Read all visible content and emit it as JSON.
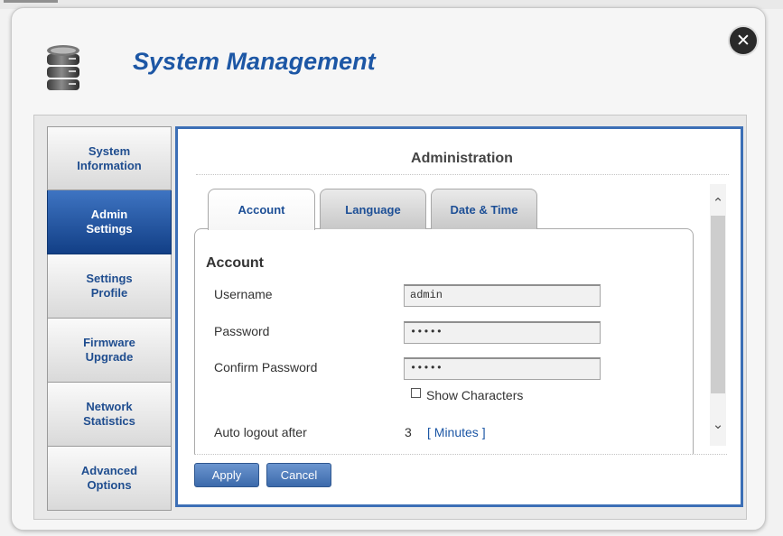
{
  "window": {
    "title": "System Management",
    "close_icon": "close-icon",
    "app_icon": "database-icon"
  },
  "sidebar": {
    "items": [
      {
        "label": "System Information"
      },
      {
        "label": "Admin Settings",
        "active": true
      },
      {
        "label": "Settings Profile"
      },
      {
        "label": "Firmware Upgrade"
      },
      {
        "label": "Network Statistics"
      },
      {
        "label": "Advanced Options"
      }
    ]
  },
  "main": {
    "title": "Administration",
    "tabs": [
      {
        "label": "Account",
        "active": true
      },
      {
        "label": "Language"
      },
      {
        "label": "Date & Time"
      }
    ],
    "account": {
      "heading": "Account",
      "username_label": "Username",
      "username_value": "admin",
      "password_label": "Password",
      "password_value": "•••••",
      "confirm_label": "Confirm Password",
      "confirm_value": "•••••",
      "show_characters_label": "Show Characters",
      "show_characters_checked": false,
      "auto_logout_label": "Auto logout after",
      "auto_logout_value": "3",
      "auto_logout_unit": "[ Minutes ]"
    },
    "buttons": {
      "apply": "Apply",
      "cancel": "Cancel"
    }
  },
  "colors": {
    "accent": "#1d57a5",
    "panel_border": "#3c6fb6",
    "active_nav": "#1a4a92"
  }
}
